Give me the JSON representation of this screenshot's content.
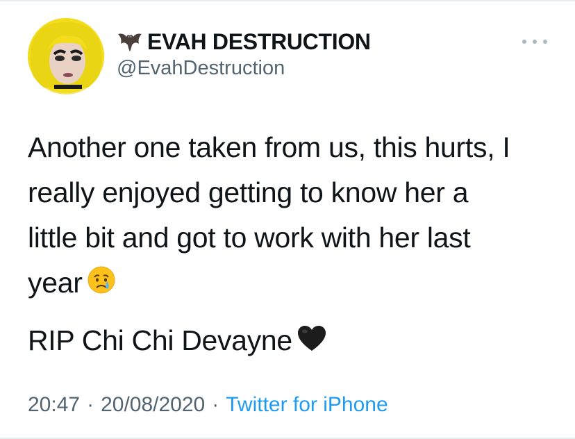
{
  "user": {
    "display_name": "EVAH DESTRUCTION",
    "handle": "@EvahDestruction",
    "name_emoji": "bat-icon",
    "avatar": "profile-avatar"
  },
  "tweet": {
    "lines": [
      "Another one taken from us, this hurts, I",
      "really enjoyed getting to know her a",
      "little bit and got to work with her last",
      "year"
    ],
    "line_emoji": "crying-face-emoji",
    "rip_text": "RIP Chi Chi Devayne",
    "rip_emoji": "black-heart-emoji"
  },
  "meta": {
    "time": "20:47",
    "separator": "·",
    "date": "20/08/2020",
    "source": "Twitter for iPhone"
  },
  "colors": {
    "text": "#0f1419",
    "secondary": "#536471",
    "link": "#1d9bf0",
    "more_dots": "#aab8c2"
  },
  "icons": {
    "more": "more-options-icon"
  }
}
